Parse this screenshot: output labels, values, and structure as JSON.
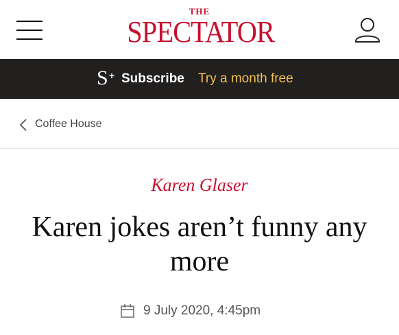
{
  "header": {
    "menu_icon": "hamburger-menu-icon",
    "logo_the": "THE",
    "logo_name": "SPECTATOR",
    "account_icon": "user-account-icon",
    "brand_color": "#c8102e"
  },
  "subscribe_bar": {
    "mark": "S",
    "mark_plus": "+",
    "subscribe_label": "Subscribe",
    "trial_label": "Try a month free",
    "background": "#221f1f",
    "accent": "#f2c14e"
  },
  "breadcrumb": {
    "icon": "chevron-left-icon",
    "label": "Coffee House"
  },
  "article": {
    "author": "Karen Glaser",
    "title": "Karen jokes aren’t funny any more",
    "date_icon": "calendar-icon",
    "date": "9 July 2020, 4:45pm"
  }
}
